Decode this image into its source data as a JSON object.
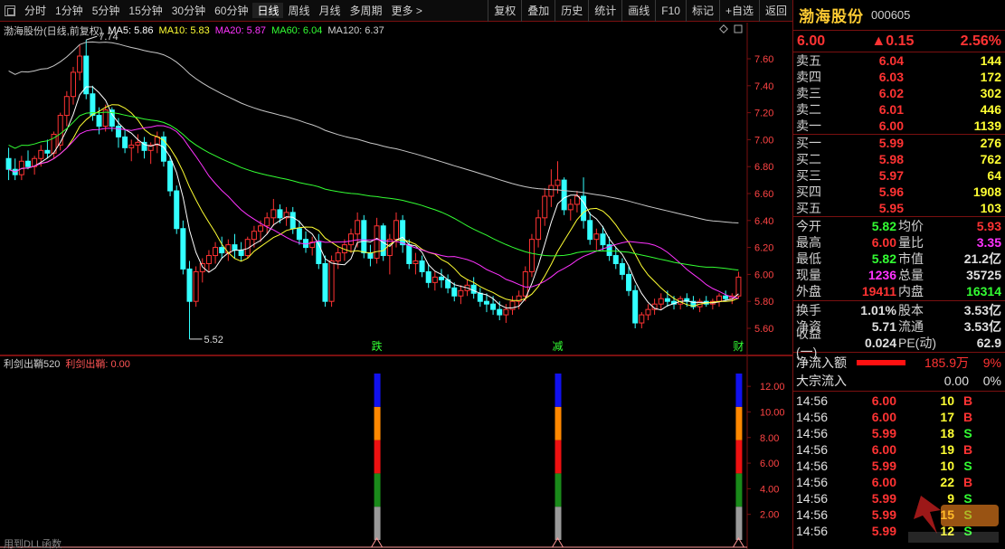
{
  "toolbar": {
    "periods": [
      "分时",
      "1分钟",
      "5分钟",
      "15分钟",
      "30分钟",
      "60分钟",
      "日线",
      "周线",
      "月线",
      "多周期",
      "更多 >"
    ],
    "active_period": "日线",
    "tools": [
      "复权",
      "叠加",
      "历史",
      "统计",
      "画线",
      "F10",
      "标记",
      "+自选",
      "返回"
    ]
  },
  "main_chart": {
    "stock_label": "渤海股份(日线,前复权)",
    "ma": [
      {
        "label": "MA5: 5.86",
        "color": "#ffffff"
      },
      {
        "label": "MA10: 5.83",
        "color": "#ffff33"
      },
      {
        "label": "MA20: 5.87",
        "color": "#ff33ff"
      },
      {
        "label": "MA60: 6.04",
        "color": "#33ff33"
      },
      {
        "label": "MA120: 6.37",
        "color": "#d0d0d0"
      }
    ],
    "high_marker": "7.74",
    "low_marker": "5.52",
    "event_marks": [
      "跌",
      "减",
      "财"
    ],
    "axis_labels": [
      "7.60",
      "7.40",
      "7.20",
      "7.00",
      "6.80",
      "6.60",
      "6.40",
      "6.20",
      "6.00",
      "5.80",
      "5.60"
    ]
  },
  "sub_chart": {
    "title": "利剑出鞘520",
    "value_label": "利剑出鞘: 0.00",
    "axis_labels": [
      "12.00",
      "10.00",
      "8.00",
      "6.00",
      "4.00",
      "2.00"
    ],
    "footer": "用到DLL函数"
  },
  "colors": {
    "up": "#ff3333",
    "down": "#33ffff",
    "ma5": "#ffffff",
    "ma10": "#ffff33",
    "ma20": "#ff33ff",
    "ma60": "#33ff33",
    "ma120": "#c8c8c8",
    "frame": "#7a1010"
  },
  "chart_data": {
    "type": "candlestick",
    "price_axis": [
      5.6,
      7.6
    ],
    "events": [
      {
        "label": "跌",
        "index": 57
      },
      {
        "label": "减",
        "index": 85
      },
      {
        "label": "财",
        "index": 113
      }
    ],
    "ohlc": [
      [
        6.86,
        6.94,
        6.7,
        6.78
      ],
      [
        6.78,
        6.86,
        6.7,
        6.74
      ],
      [
        6.74,
        6.88,
        6.7,
        6.84
      ],
      [
        6.84,
        6.92,
        6.78,
        6.8
      ],
      [
        6.8,
        6.88,
        6.74,
        6.86
      ],
      [
        6.86,
        6.96,
        6.8,
        6.92
      ],
      [
        6.92,
        7.0,
        6.86,
        6.9
      ],
      [
        6.9,
        7.06,
        6.86,
        7.04
      ],
      [
        6.96,
        7.2,
        6.92,
        7.18
      ],
      [
        7.18,
        7.36,
        7.1,
        7.32
      ],
      [
        7.32,
        7.54,
        7.26,
        7.5
      ],
      [
        7.5,
        7.7,
        7.44,
        7.62
      ],
      [
        7.62,
        7.74,
        7.3,
        7.34
      ],
      [
        7.34,
        7.4,
        7.14,
        7.18
      ],
      [
        7.18,
        7.24,
        7.04,
        7.1
      ],
      [
        7.1,
        7.26,
        7.06,
        7.22
      ],
      [
        7.22,
        7.24,
        7.06,
        7.1
      ],
      [
        7.1,
        7.16,
        6.94,
        7.02
      ],
      [
        7.02,
        7.08,
        6.9,
        6.94
      ],
      [
        6.94,
        7.0,
        6.84,
        6.96
      ],
      [
        6.96,
        7.04,
        6.9,
        6.98
      ],
      [
        6.98,
        7.02,
        6.86,
        6.92
      ],
      [
        6.92,
        6.98,
        6.82,
        6.96
      ],
      [
        6.96,
        7.06,
        6.9,
        7.02
      ],
      [
        7.02,
        7.06,
        6.8,
        6.84
      ],
      [
        6.84,
        6.88,
        6.58,
        6.62
      ],
      [
        6.62,
        6.66,
        6.3,
        6.34
      ],
      [
        6.34,
        6.4,
        6.0,
        6.04
      ],
      [
        6.04,
        6.1,
        5.52,
        5.8
      ],
      [
        5.8,
        6.06,
        5.76,
        6.02
      ],
      [
        6.02,
        6.12,
        5.94,
        6.08
      ],
      [
        6.08,
        6.18,
        6.02,
        6.14
      ],
      [
        6.14,
        6.24,
        6.08,
        6.2
      ],
      [
        6.2,
        6.28,
        6.12,
        6.16
      ],
      [
        6.16,
        6.26,
        6.1,
        6.22
      ],
      [
        6.22,
        6.3,
        6.12,
        6.18
      ],
      [
        6.18,
        6.24,
        6.1,
        6.14
      ],
      [
        6.14,
        6.28,
        6.12,
        6.26
      ],
      [
        6.26,
        6.36,
        6.2,
        6.32
      ],
      [
        6.32,
        6.4,
        6.24,
        6.36
      ],
      [
        6.36,
        6.46,
        6.3,
        6.42
      ],
      [
        6.42,
        6.56,
        6.36,
        6.48
      ],
      [
        6.48,
        6.52,
        6.38,
        6.42
      ],
      [
        6.42,
        6.5,
        6.36,
        6.46
      ],
      [
        6.46,
        6.5,
        6.3,
        6.34
      ],
      [
        6.34,
        6.4,
        6.22,
        6.26
      ],
      [
        6.26,
        6.32,
        6.16,
        6.2
      ],
      [
        6.2,
        6.28,
        6.14,
        6.24
      ],
      [
        6.24,
        6.3,
        6.04,
        6.08
      ],
      [
        6.08,
        6.14,
        5.76,
        5.8
      ],
      [
        5.8,
        6.14,
        5.76,
        6.1
      ],
      [
        6.1,
        6.2,
        6.04,
        6.16
      ],
      [
        6.16,
        6.26,
        6.1,
        6.22
      ],
      [
        6.22,
        6.34,
        6.16,
        6.3
      ],
      [
        6.3,
        6.46,
        6.2,
        6.4
      ],
      [
        6.4,
        6.44,
        6.12,
        6.16
      ],
      [
        6.16,
        6.22,
        6.06,
        6.12
      ],
      [
        6.12,
        6.42,
        6.08,
        6.36
      ],
      [
        6.36,
        6.38,
        6.1,
        6.14
      ],
      [
        6.14,
        6.3,
        6.0,
        6.26
      ],
      [
        6.26,
        6.46,
        6.2,
        6.4
      ],
      [
        6.4,
        6.44,
        6.16,
        6.22
      ],
      [
        6.22,
        6.26,
        6.04,
        6.08
      ],
      [
        6.08,
        6.16,
        6.0,
        6.1
      ],
      [
        6.1,
        6.14,
        5.98,
        6.02
      ],
      [
        6.02,
        6.08,
        5.9,
        5.94
      ],
      [
        5.94,
        6.02,
        5.88,
        5.98
      ],
      [
        5.98,
        6.04,
        5.9,
        5.96
      ],
      [
        5.96,
        6.0,
        5.86,
        5.9
      ],
      [
        5.9,
        5.94,
        5.8,
        5.84
      ],
      [
        5.84,
        5.92,
        5.78,
        5.88
      ],
      [
        5.88,
        5.96,
        5.84,
        5.92
      ],
      [
        5.92,
        5.98,
        5.82,
        5.86
      ],
      [
        5.86,
        5.9,
        5.76,
        5.8
      ],
      [
        5.8,
        5.86,
        5.72,
        5.78
      ],
      [
        5.78,
        5.84,
        5.7,
        5.74
      ],
      [
        5.74,
        5.8,
        5.66,
        5.7
      ],
      [
        5.7,
        5.78,
        5.64,
        5.74
      ],
      [
        5.74,
        5.84,
        5.7,
        5.8
      ],
      [
        5.8,
        5.88,
        5.74,
        5.84
      ],
      [
        5.84,
        6.06,
        5.8,
        6.02
      ],
      [
        6.02,
        6.3,
        5.98,
        6.26
      ],
      [
        6.26,
        6.48,
        6.2,
        6.42
      ],
      [
        6.42,
        6.64,
        6.36,
        6.58
      ],
      [
        6.58,
        6.78,
        6.5,
        6.66
      ],
      [
        6.66,
        6.84,
        6.6,
        6.7
      ],
      [
        6.7,
        6.72,
        6.44,
        6.48
      ],
      [
        6.48,
        6.56,
        6.4,
        6.52
      ],
      [
        6.52,
        6.62,
        6.46,
        6.58
      ],
      [
        6.58,
        6.72,
        6.34,
        6.4
      ],
      [
        6.4,
        6.46,
        6.22,
        6.26
      ],
      [
        6.26,
        6.34,
        6.18,
        6.3
      ],
      [
        6.3,
        6.36,
        6.18,
        6.22
      ],
      [
        6.22,
        6.28,
        6.1,
        6.14
      ],
      [
        6.14,
        6.2,
        6.04,
        6.08
      ],
      [
        6.08,
        6.12,
        5.96,
        6.0
      ],
      [
        6.0,
        6.06,
        5.84,
        5.88
      ],
      [
        5.88,
        5.92,
        5.6,
        5.64
      ],
      [
        5.64,
        5.72,
        5.6,
        5.7
      ],
      [
        5.7,
        5.78,
        5.66,
        5.74
      ],
      [
        5.74,
        5.82,
        5.7,
        5.78
      ],
      [
        5.78,
        5.86,
        5.74,
        5.82
      ],
      [
        5.82,
        5.88,
        5.76,
        5.8
      ],
      [
        5.8,
        5.84,
        5.74,
        5.78
      ],
      [
        5.78,
        5.84,
        5.74,
        5.82
      ],
      [
        5.82,
        5.86,
        5.76,
        5.8
      ],
      [
        5.8,
        5.84,
        5.74,
        5.76
      ],
      [
        5.76,
        5.82,
        5.72,
        5.8
      ],
      [
        5.8,
        5.84,
        5.76,
        5.78
      ],
      [
        5.78,
        5.82,
        5.74,
        5.8
      ],
      [
        5.8,
        5.86,
        5.76,
        5.84
      ],
      [
        5.84,
        5.88,
        5.8,
        5.82
      ],
      [
        5.82,
        5.86,
        5.78,
        5.84
      ],
      [
        5.84,
        6.02,
        5.82,
        5.98
      ]
    ]
  },
  "sub_signals": [
    57,
    85,
    113
  ],
  "sub_signal_colors": [
    "#9a9a9a",
    "#1a8a1a",
    "#ee1111",
    "#ff8800",
    "#1111ee"
  ],
  "quote": {
    "name": "渤海股份",
    "code": "000605",
    "price": "6.00",
    "change": "▲0.15",
    "change_pct": "2.56%",
    "sell": [
      {
        "label": "卖五",
        "price": "6.04",
        "vol": "144"
      },
      {
        "label": "卖四",
        "price": "6.03",
        "vol": "172"
      },
      {
        "label": "卖三",
        "price": "6.02",
        "vol": "302"
      },
      {
        "label": "卖二",
        "price": "6.01",
        "vol": "446"
      },
      {
        "label": "卖一",
        "price": "6.00",
        "vol": "1139"
      }
    ],
    "buy": [
      {
        "label": "买一",
        "price": "5.99",
        "vol": "276"
      },
      {
        "label": "买二",
        "price": "5.98",
        "vol": "762"
      },
      {
        "label": "买三",
        "price": "5.97",
        "vol": "64"
      },
      {
        "label": "买四",
        "price": "5.96",
        "vol": "1908"
      },
      {
        "label": "买五",
        "price": "5.95",
        "vol": "103"
      }
    ],
    "stats": [
      {
        "l1": "今开",
        "v1": "5.82",
        "c1": "green",
        "l2": "均价",
        "v2": "5.93",
        "c2": "red"
      },
      {
        "l1": "最高",
        "v1": "6.00",
        "c1": "red",
        "l2": "量比",
        "v2": "3.35",
        "c2": "magenta"
      },
      {
        "l1": "最低",
        "v1": "5.82",
        "c1": "green",
        "l2": "市值",
        "v2": "21.2亿",
        "c2": "white"
      },
      {
        "l1": "现量",
        "v1": "1236",
        "c1": "magenta",
        "l2": "总量",
        "v2": "35725",
        "c2": "white"
      },
      {
        "l1": "外盘",
        "v1": "19411",
        "c1": "red",
        "l2": "内盘",
        "v2": "16314",
        "c2": "green"
      }
    ],
    "stats2": [
      {
        "l1": "换手",
        "v1": "1.01%",
        "c1": "white",
        "l2": "股本",
        "v2": "3.53亿",
        "c2": "white"
      },
      {
        "l1": "净资",
        "v1": "5.71",
        "c1": "white",
        "l2": "流通",
        "v2": "3.53亿",
        "c2": "white"
      },
      {
        "l1": "收益(一)",
        "v1": "0.024",
        "c1": "white",
        "l2": "PE(动)",
        "v2": "62.9",
        "c2": "white"
      }
    ],
    "flow": [
      {
        "label": "净流入额",
        "value": "185.9万",
        "pct": "9%",
        "bar": true
      },
      {
        "label": "大宗流入",
        "value": "0.00",
        "pct": "0%",
        "bar": false
      }
    ],
    "ticks": [
      {
        "time": "14:56",
        "price": "6.00",
        "vol": "10",
        "dir": "B"
      },
      {
        "time": "14:56",
        "price": "6.00",
        "vol": "17",
        "dir": "B"
      },
      {
        "time": "14:56",
        "price": "5.99",
        "vol": "18",
        "dir": "S"
      },
      {
        "time": "14:56",
        "price": "6.00",
        "vol": "19",
        "dir": "B"
      },
      {
        "time": "14:56",
        "price": "5.99",
        "vol": "10",
        "dir": "S"
      },
      {
        "time": "14:56",
        "price": "6.00",
        "vol": "22",
        "dir": "B"
      },
      {
        "time": "14:56",
        "price": "5.99",
        "vol": "9",
        "dir": "S"
      },
      {
        "time": "14:56",
        "price": "5.99",
        "vol": "15",
        "dir": "S"
      },
      {
        "time": "14:56",
        "price": "5.99",
        "vol": "12",
        "dir": "S"
      }
    ]
  }
}
